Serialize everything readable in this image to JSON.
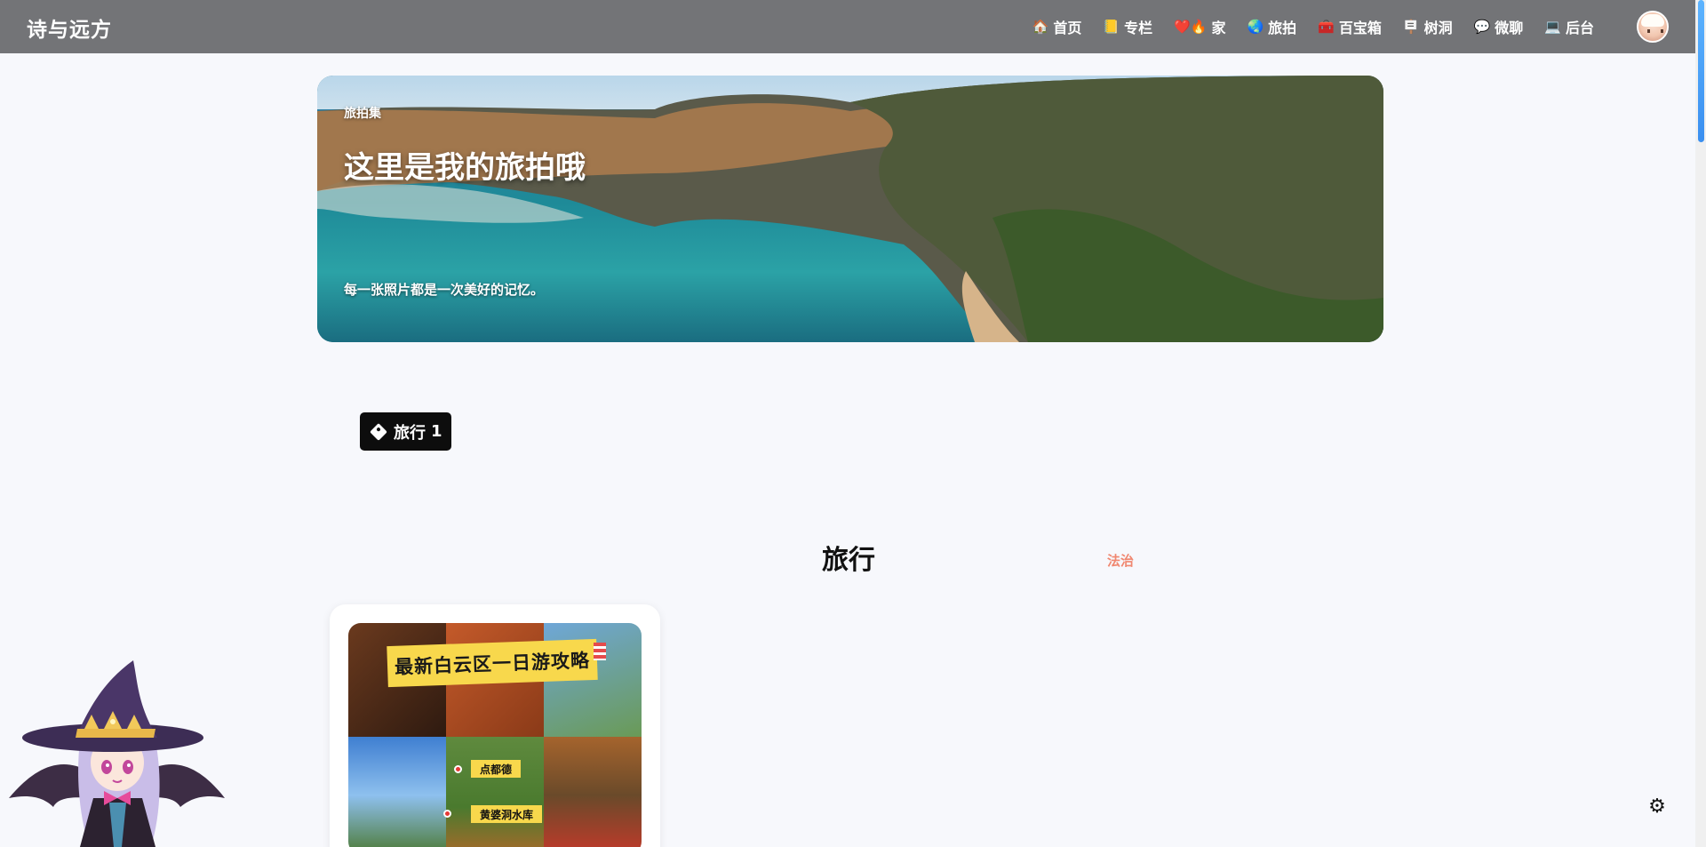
{
  "site": {
    "title": "诗与远方"
  },
  "nav": {
    "items": [
      {
        "icon": "home-icon",
        "glyph": "🏠",
        "label": "首页"
      },
      {
        "icon": "column-icon",
        "glyph": "📒",
        "label": "专栏"
      },
      {
        "icon": "heart-fire-icon",
        "glyph": "❤️🔥",
        "label": "家"
      },
      {
        "icon": "globe-icon",
        "glyph": "🌏",
        "label": "旅拍"
      },
      {
        "icon": "toolbox-icon",
        "glyph": "🧰",
        "label": "百宝箱"
      },
      {
        "icon": "signpost-icon",
        "glyph": "🪧",
        "label": "树洞"
      },
      {
        "icon": "chat-icon",
        "glyph": "💬",
        "label": "微聊"
      },
      {
        "icon": "laptop-icon",
        "glyph": "💻",
        "label": "后台"
      }
    ]
  },
  "hero": {
    "label": "旅拍集",
    "title": "这里是我的旅拍哦",
    "subtitle": "每一张照片都是一次美好的记忆。"
  },
  "tag": {
    "label": "旅行",
    "count": "1"
  },
  "section": {
    "title": "旅行",
    "side_link": "法治"
  },
  "card": {
    "cover_title": "最新白云区一日游攻略",
    "cover_tag_1": "点都德",
    "cover_tag_2": "黄婆洞水库"
  },
  "settings": {
    "icon": "gear-icon",
    "glyph": "⚙"
  },
  "colors": {
    "topbar": "#737477",
    "background": "#f7f8fc",
    "tag_chip": "#0d0d0d",
    "accent_link": "#f08770",
    "cover_banner": "#f8d84c"
  }
}
